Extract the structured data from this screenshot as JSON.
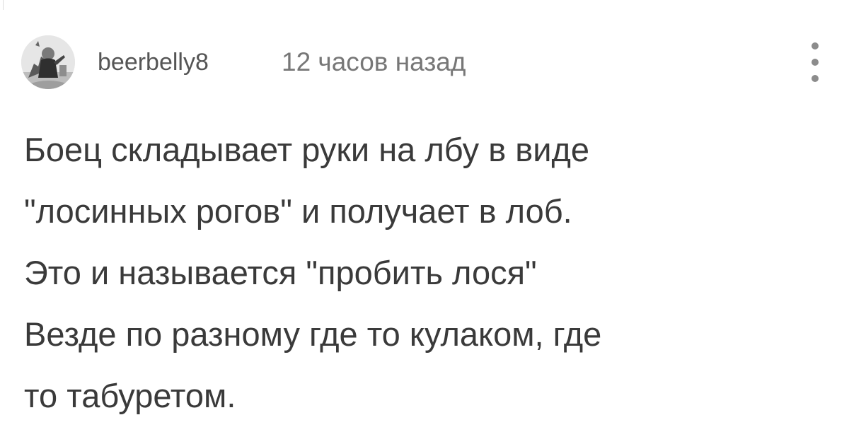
{
  "comment": {
    "author": {
      "username": "beerbelly8",
      "avatar_icon": "user-avatar-photo"
    },
    "timestamp": "12 часов назад",
    "menu_icon": "more-vertical-icon",
    "text_lines": [
      "Боец складывает руки на лбу в виде",
      "\"лосинных рогов\" и получает в лоб.",
      "Это и называется \"пробить лося\"",
      "Везде по разному где то кулаком, где",
      "то табуретом."
    ]
  }
}
